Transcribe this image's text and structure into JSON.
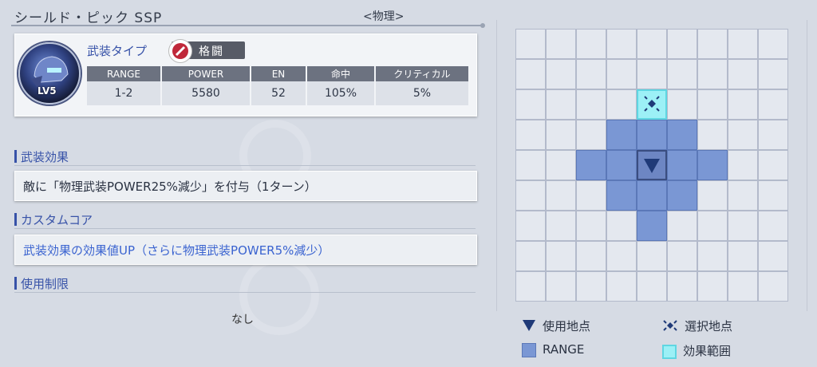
{
  "header": {
    "title": "シールド・ピック SSP",
    "type_tag": "<物理>"
  },
  "weapon": {
    "level": "LV5",
    "type_label": "武装タイプ",
    "type_value": "格闘",
    "stats_headers": [
      "RANGE",
      "POWER",
      "EN",
      "命中",
      "クリティカル"
    ],
    "stats_values": [
      "1-2",
      "5580",
      "52",
      "105%",
      "5%"
    ]
  },
  "sections": {
    "effect_title": "武装効果",
    "effect_text": "敵に「物理武装POWER25%減少」を付与（1ターン）",
    "core_title": "カスタムコア",
    "core_text": "武装効果の効果値UP（さらに物理武装POWER5%減少）",
    "limit_title": "使用制限",
    "limit_text": "なし"
  },
  "legend": {
    "use_point": "使用地点",
    "select_point": "選択地点",
    "range": "RANGE",
    "effect_area": "効果範囲"
  },
  "colors": {
    "accent": "#3752a8",
    "range": "#7a97d4",
    "effect_area": "#9cf0f6",
    "use_point": "#1f3a78"
  },
  "grid_map": {
    "size": 9,
    "select_cell": [
      4,
      2
    ],
    "use_cell": [
      4,
      4
    ],
    "range_cells": [
      [
        3,
        3
      ],
      [
        4,
        3
      ],
      [
        5,
        3
      ],
      [
        2,
        4
      ],
      [
        3,
        4
      ],
      [
        5,
        4
      ],
      [
        6,
        4
      ],
      [
        3,
        5
      ],
      [
        4,
        5
      ],
      [
        5,
        5
      ],
      [
        4,
        6
      ]
    ]
  }
}
